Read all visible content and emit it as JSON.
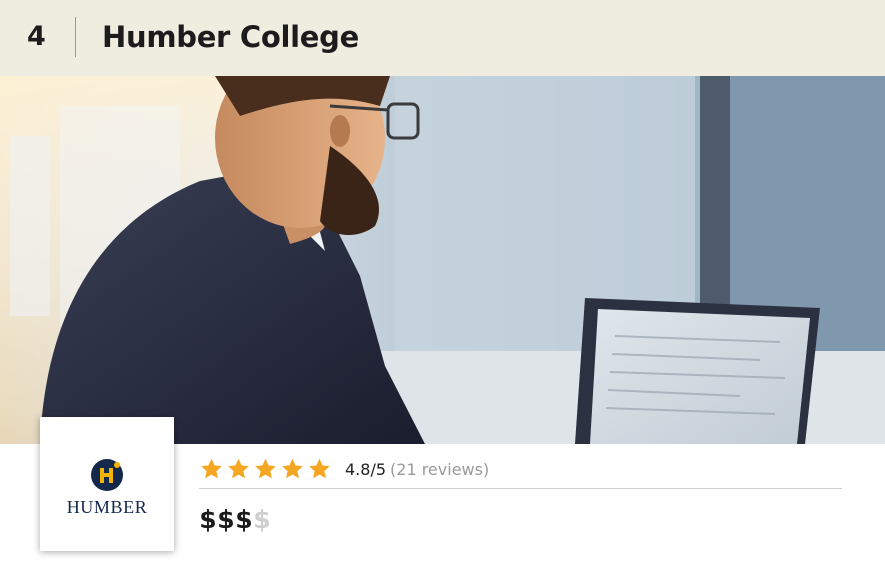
{
  "listing": {
    "rank": "4",
    "name": "Humber College"
  },
  "hero_image": {
    "description_icon": "photo-icon"
  },
  "logo": {
    "text": "HUMBER",
    "colors": {
      "navy": "#14284b",
      "gold": "#f2b400"
    }
  },
  "rating": {
    "stars": 5,
    "max_stars": 5,
    "score_text": "4.8/5",
    "reviews_text": "(21 reviews)",
    "star_color": "#f5a623"
  },
  "price": {
    "symbols": [
      "$",
      "$",
      "$",
      "$"
    ],
    "active_count": 3
  }
}
